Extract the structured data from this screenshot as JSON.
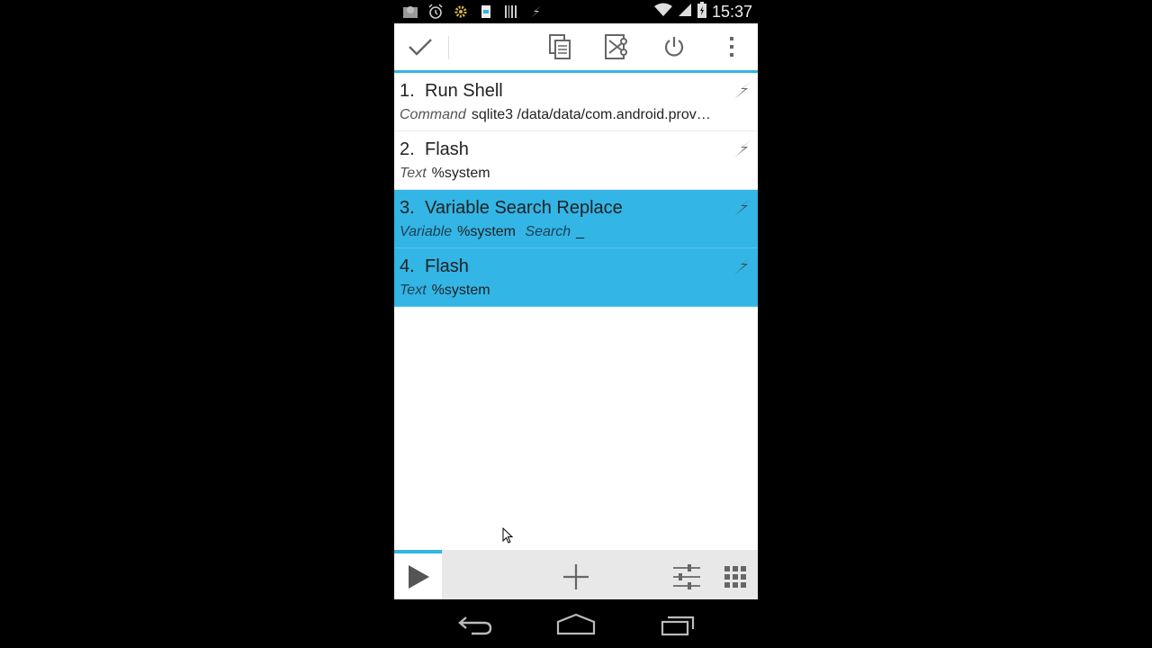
{
  "status_bar": {
    "time": "15:37",
    "icons": [
      "image-icon",
      "alarm-icon",
      "settings-icon",
      "sim-icon",
      "barcode-icon",
      "bolt-icon",
      "wifi-icon",
      "signal-icon",
      "battery-icon"
    ]
  },
  "action_bar": {
    "buttons": [
      "done-check-icon",
      "copy-icon",
      "cut-icon",
      "power-icon",
      "overflow-menu-icon"
    ]
  },
  "actions": [
    {
      "number": "1.",
      "title": "Run Shell",
      "param_label": "Command",
      "param_value": "sqlite3 /data/data/com.android.prov…",
      "selected": false
    },
    {
      "number": "2.",
      "title": "Flash",
      "param_label": "Text",
      "param_value": "%system",
      "selected": false
    },
    {
      "number": "3.",
      "title": "Variable Search Replace",
      "param_label": "Variable",
      "param_value": "%system",
      "param2_label": "Search",
      "param2_value": "_",
      "selected": true
    },
    {
      "number": "4.",
      "title": "Flash",
      "param_label": "Text",
      "param_value": "%system",
      "selected": true
    }
  ],
  "bottom_bar": {
    "buttons": [
      "play-icon",
      "add-icon",
      "sliders-icon",
      "grid-icon"
    ]
  },
  "nav_bar": {
    "buttons": [
      "back-icon",
      "home-icon",
      "recents-icon"
    ]
  },
  "colors": {
    "accent": "#33b5e5",
    "background": "#000000"
  }
}
